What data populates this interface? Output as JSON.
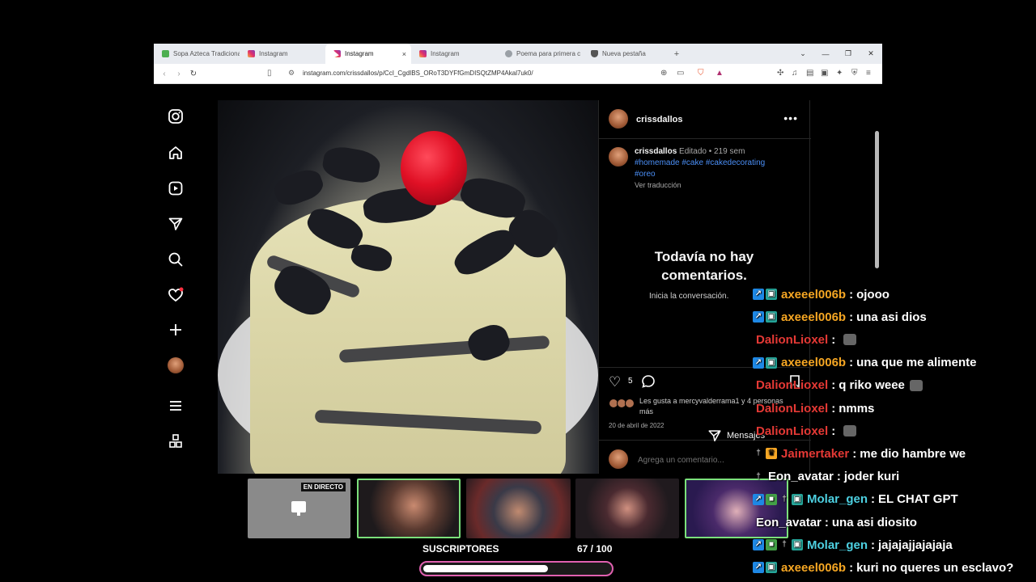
{
  "browser": {
    "tabs": [
      {
        "label": "Sopa Azteca Tradiciona",
        "icon": "green-leaf-icon",
        "active": false
      },
      {
        "label": "Instagram",
        "icon": "instagram-icon",
        "active": false
      },
      {
        "label": "Instagram",
        "icon": "instagram-icon",
        "active": true
      },
      {
        "label": "Instagram",
        "icon": "instagram-icon",
        "active": false
      },
      {
        "label": "Poema para primera c",
        "icon": "globe-icon",
        "active": false
      },
      {
        "label": "Nueva pestaña",
        "icon": "brave-shield-icon",
        "active": false
      }
    ],
    "new_tab": "+",
    "close_tab": "×",
    "url": "instagram.com/crissdallos/p/CcI_CgdIBS_ORoT3DYFfGmDISQtZMP4Akal7uk0/"
  },
  "instagram": {
    "sidebar": [
      "instagram-logo-icon",
      "home-icon",
      "reels-icon",
      "direct-message-icon",
      "search-icon",
      "notifications-heart-icon",
      "create-plus-icon",
      "profile-avatar",
      "menu-icon",
      "more-apps-icon"
    ],
    "post": {
      "username": "crissdallos",
      "caption_user": "crissdallos",
      "caption_edited": "Editado",
      "caption_dot": "•",
      "caption_time": "219 sem",
      "hashtags_line1": "#homemade #cake #cakedecorating",
      "hashtags_line2": "#oreo",
      "see_translation": "Ver traducción",
      "no_comments_title": "Todavía no hay comentarios.",
      "no_comments_sub": "Inicia la conversación.",
      "likes_count": "5",
      "likes_text": "Les gusta a mercyvalderrama1 y 4 personas más",
      "date": "20 de abril de 2022",
      "comment_placeholder": "Agrega un comentario...",
      "messages_label": "Mensajes"
    }
  },
  "stream": {
    "live_label": "EN DIRECTO",
    "subs_label": "SUSCRIPTORES",
    "subs_count": "67 / 100",
    "subs_progress": 0.67
  },
  "chat": [
    {
      "user": "axeeel006b",
      "color": "#f5a623",
      "badges": [
        "arrow",
        "gift"
      ],
      "text": "ojooo"
    },
    {
      "user": "axeeel006b",
      "color": "#f5a623",
      "badges": [
        "arrow",
        "gift"
      ],
      "text": "una asi dios"
    },
    {
      "user": "DalionLioxel",
      "color": "#e53935",
      "badges": [],
      "text": "",
      "emote": true
    },
    {
      "user": "axeeel006b",
      "color": "#f5a623",
      "badges": [
        "arrow",
        "gift"
      ],
      "text": "una que me alimente"
    },
    {
      "user": "DalionLioxel",
      "color": "#e53935",
      "badges": [],
      "text": "q riko weee",
      "emote": true
    },
    {
      "user": "DalionLioxel",
      "color": "#e53935",
      "badges": [],
      "text": "nmms"
    },
    {
      "user": "DalionLioxel",
      "color": "#e53935",
      "badges": [],
      "text": "",
      "emote": true
    },
    {
      "user": "Jaimertaker",
      "color": "#e53935",
      "badges": [
        "sword",
        "crown"
      ],
      "text": "me dio hambre we"
    },
    {
      "user": "Eon_avatar",
      "color": "#ffffff",
      "badges": [
        "sword"
      ],
      "text": "joder kuri"
    },
    {
      "user": "Molar_gen",
      "color": "#4dd0e1",
      "badges": [
        "arrow",
        "green",
        "sword",
        "gift"
      ],
      "text": "EL CHAT GPT"
    },
    {
      "user": "Eon_avatar",
      "color": "#ffffff",
      "badges": [],
      "text": "una asi diosito"
    },
    {
      "user": "Molar_gen",
      "color": "#4dd0e1",
      "badges": [
        "arrow",
        "green",
        "sword",
        "gift"
      ],
      "text": "jajajajjajajaja"
    },
    {
      "user": "axeeel006b",
      "color": "#f5a623",
      "badges": [
        "arrow",
        "gift"
      ],
      "text": "kuri no queres un esclavo?"
    }
  ]
}
